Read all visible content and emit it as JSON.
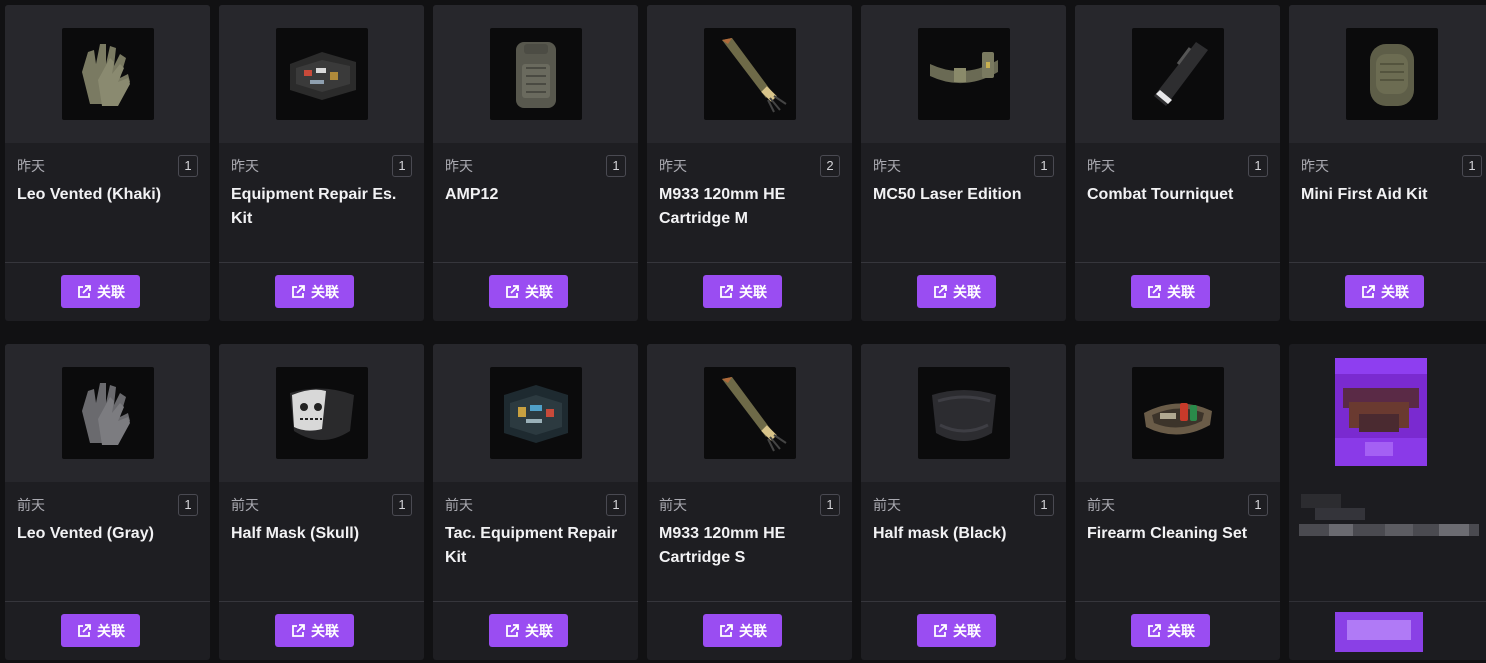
{
  "link_label": "关联",
  "colors": {
    "accent": "#9a4df2",
    "card": "#1e1e22",
    "page": "#111113"
  },
  "items": [
    {
      "date": "昨天",
      "qty": "1",
      "name": "Leo Vented (Khaki)",
      "icon": "gloves-khaki-icon"
    },
    {
      "date": "昨天",
      "qty": "1",
      "name": "Equipment Repair Es. Kit",
      "icon": "repair-case-icon"
    },
    {
      "date": "昨天",
      "qty": "1",
      "name": "AMP12",
      "icon": "backpack-icon"
    },
    {
      "date": "昨天",
      "qty": "2",
      "name": "M933 120mm HE Cartridge M",
      "icon": "mortar-shell-icon"
    },
    {
      "date": "昨天",
      "qty": "1",
      "name": "MC50 Laser Edition",
      "icon": "belt-icon"
    },
    {
      "date": "昨天",
      "qty": "1",
      "name": "Combat Tourniquet",
      "icon": "tourniquet-icon"
    },
    {
      "date": "昨天",
      "qty": "1",
      "name": "Mini First Aid Kit",
      "icon": "first-aid-pouch-icon"
    },
    {
      "date": "前天",
      "qty": "1",
      "name": "Leo Vented (Gray)",
      "icon": "gloves-gray-icon"
    },
    {
      "date": "前天",
      "qty": "1",
      "name": "Half Mask (Skull)",
      "icon": "skull-mask-icon"
    },
    {
      "date": "前天",
      "qty": "1",
      "name": "Tac. Equipment Repair Kit",
      "icon": "tac-repair-case-icon"
    },
    {
      "date": "前天",
      "qty": "1",
      "name": "M933 120mm HE Cartridge S",
      "icon": "mortar-shell-icon"
    },
    {
      "date": "前天",
      "qty": "1",
      "name": "Half mask (Black)",
      "icon": "black-mask-icon"
    },
    {
      "date": "前天",
      "qty": "1",
      "name": "Firearm Cleaning Set",
      "icon": "cleaning-kit-icon"
    }
  ]
}
